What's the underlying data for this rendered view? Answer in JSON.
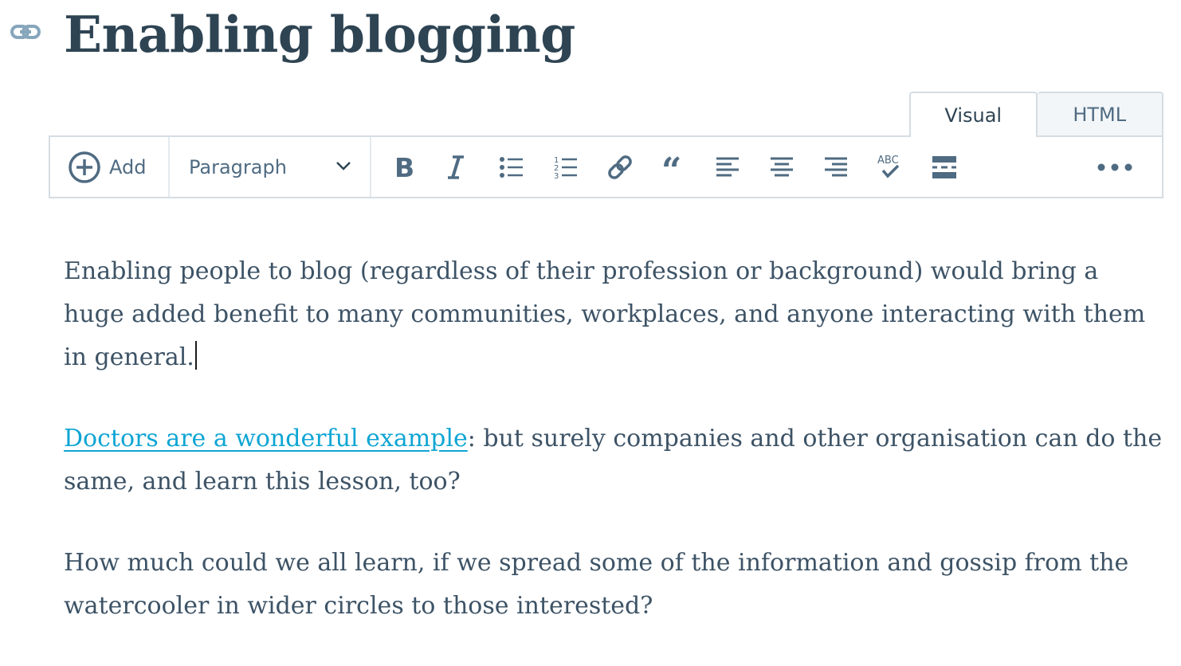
{
  "post": {
    "title": "Enabling blogging"
  },
  "editor": {
    "tabs": [
      "Visual",
      "HTML"
    ],
    "active_tab": "Visual",
    "toolbar": {
      "add_label": "Add",
      "format_select_value": "Paragraph",
      "buttons": [
        {
          "name": "bold",
          "icon": "bold-icon"
        },
        {
          "name": "italic",
          "icon": "italic-icon"
        },
        {
          "name": "bulleted-list",
          "icon": "bulleted-list-icon"
        },
        {
          "name": "numbered-list",
          "icon": "numbered-list-icon"
        },
        {
          "name": "link",
          "icon": "link-icon"
        },
        {
          "name": "blockquote",
          "icon": "blockquote-icon"
        },
        {
          "name": "align-left",
          "icon": "align-left-icon"
        },
        {
          "name": "align-center",
          "icon": "align-center-icon"
        },
        {
          "name": "align-right",
          "icon": "align-right-icon"
        },
        {
          "name": "spellcheck",
          "icon": "spellcheck-icon",
          "text": "ABC"
        },
        {
          "name": "read-more",
          "icon": "read-more-icon"
        },
        {
          "name": "more",
          "icon": "more-icon"
        }
      ]
    }
  },
  "content": {
    "paragraph_1": "Enabling people to blog (regardless of their profession or background) would bring a huge added benefit to many communities, workplaces, and anyone interacting with them in general.",
    "paragraph_2_link": "Doctors are a wonderful example",
    "paragraph_2_rest": ": but surely companies and other organisation can do the same, and learn this lesson, too?",
    "paragraph_3": "How much could we all learn, if we spread some of the information and gossip from the watercooler in wider circles to those interested?"
  },
  "colors": {
    "title": "#2e4453",
    "text": "#3d5366",
    "icon": "#4f6b82",
    "link": "#0ea5d4",
    "border": "#d5dde4"
  }
}
